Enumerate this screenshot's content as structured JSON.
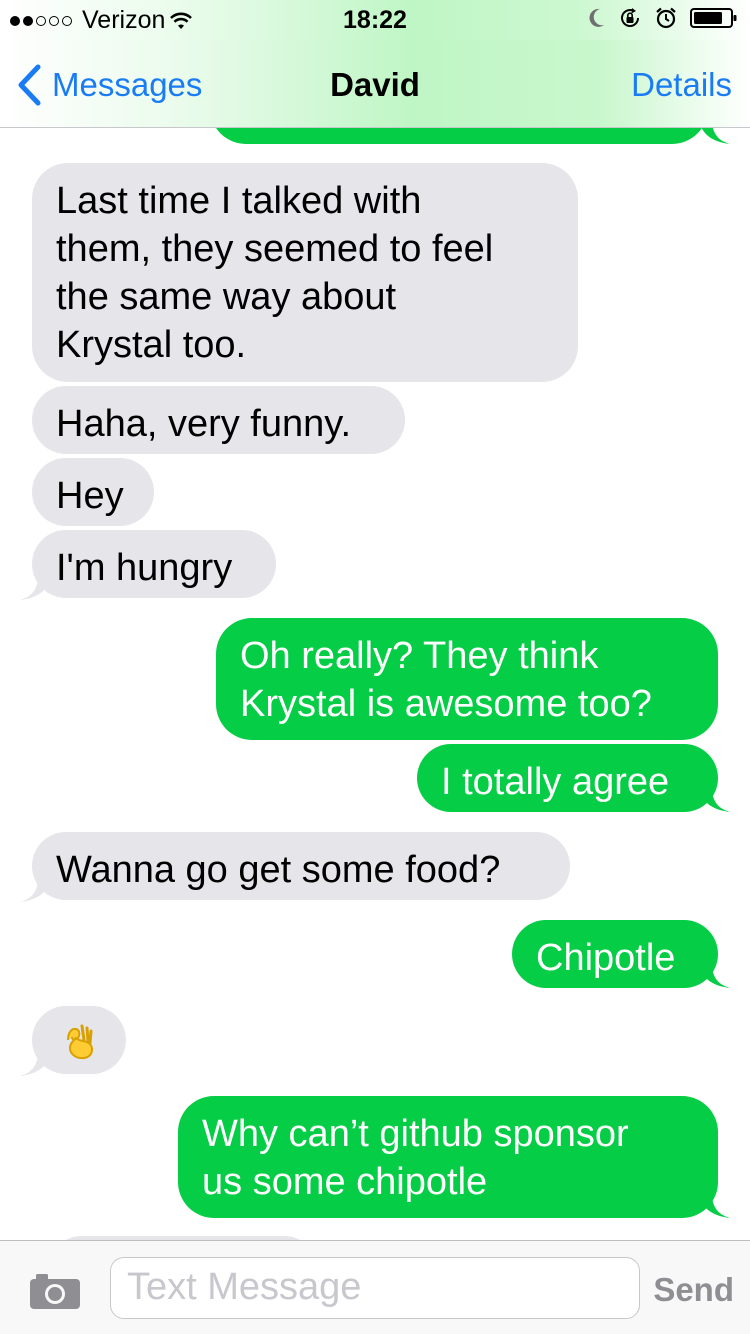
{
  "status_bar": {
    "signal_filled": 2,
    "signal_total": 5,
    "carrier": "Verizon",
    "time": "18:22",
    "icons": [
      "wifi-icon",
      "moon-icon",
      "rotation-lock-icon",
      "alarm-icon",
      "battery-icon"
    ]
  },
  "nav": {
    "back_label": "Messages",
    "title": "David",
    "details_label": "Details"
  },
  "messages": [
    {
      "from": "me",
      "text": ""
    },
    {
      "from": "them",
      "text": "Last time I talked with them, they seemed to feel the same way about Krystal too.",
      "lines": [
        "Last time I talked with",
        "them, they seemed to feel",
        "the same way about",
        "Krystal too."
      ]
    },
    {
      "from": "them",
      "text": "Haha, very funny."
    },
    {
      "from": "them",
      "text": "Hey"
    },
    {
      "from": "them",
      "text": "I'm hungry"
    },
    {
      "from": "me",
      "text": "Oh really? They think Krystal is awesome too?",
      "lines": [
        "Oh really? They think",
        "Krystal is awesome too?"
      ]
    },
    {
      "from": "me",
      "text": "I totally agree"
    },
    {
      "from": "them",
      "text": "Wanna go get some food?"
    },
    {
      "from": "me",
      "text": "Chipotle"
    },
    {
      "from": "them",
      "text": "👌",
      "emoji": "ok-hand"
    },
    {
      "from": "me",
      "text": "Why can’t github sponsor us some chipotle",
      "lines": [
        "Why can’t github sponsor",
        "us some chipotle"
      ]
    },
    {
      "from": "them",
      "text": ""
    }
  ],
  "input_bar": {
    "placeholder": "Text Message",
    "send_label": "Send"
  },
  "colors": {
    "sent_bubble": "#05cd45",
    "received_bubble": "#e5e5ea",
    "ios_blue": "#1a7cf4",
    "send_disabled": "#8e8e93"
  }
}
